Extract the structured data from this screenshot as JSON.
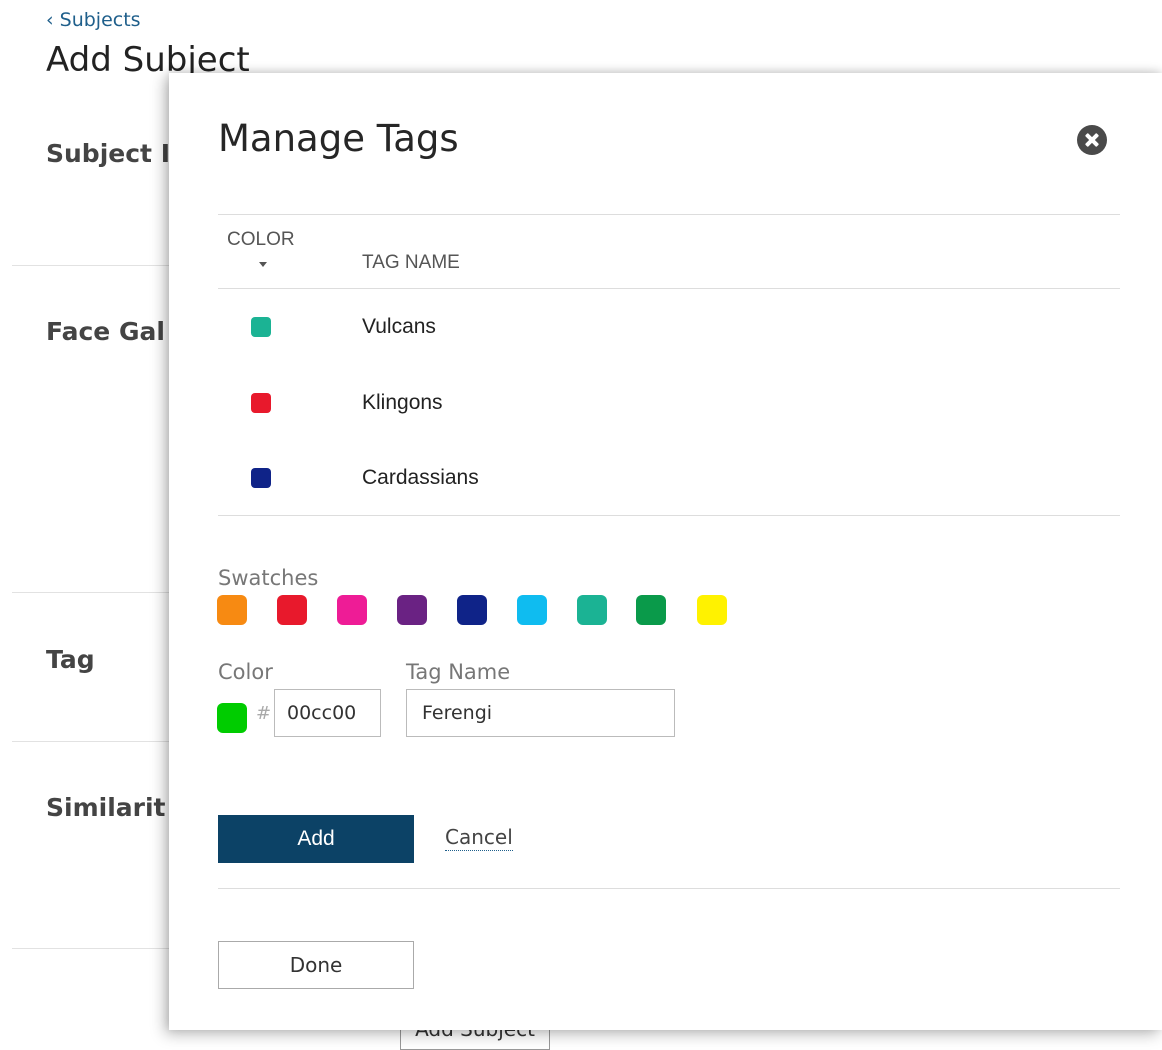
{
  "background": {
    "back_link": "‹ Subjects",
    "page_title": "Add Subject",
    "sections": [
      "Subject I",
      "Face Gal",
      "Tag",
      "Similarit"
    ],
    "add_subject_button": "Add Subject"
  },
  "modal": {
    "title": "Manage Tags",
    "close_icon": "close-circle-icon",
    "table": {
      "col_color": "COLOR",
      "col_tag_name": "TAG NAME",
      "sort_icon": "caret-down-icon",
      "rows": [
        {
          "color": "#1bb394",
          "name": "Vulcans"
        },
        {
          "color": "#e8192c",
          "name": "Klingons"
        },
        {
          "color": "#0f2388",
          "name": "Cardassians"
        }
      ]
    },
    "swatches_label": "Swatches",
    "swatches": [
      "#f78a12",
      "#e8192c",
      "#ee1c96",
      "#6a2283",
      "#0f2388",
      "#0fbcf0",
      "#1bb394",
      "#0a9a4a",
      "#fff200"
    ],
    "color_label": "Color",
    "hash": "#",
    "hex_value": "00cc00",
    "current_color": "#00cc00",
    "tag_name_label": "Tag Name",
    "tag_name_value": "Ferengi",
    "add_button": "Add",
    "cancel_link": "Cancel",
    "done_button": "Done"
  }
}
